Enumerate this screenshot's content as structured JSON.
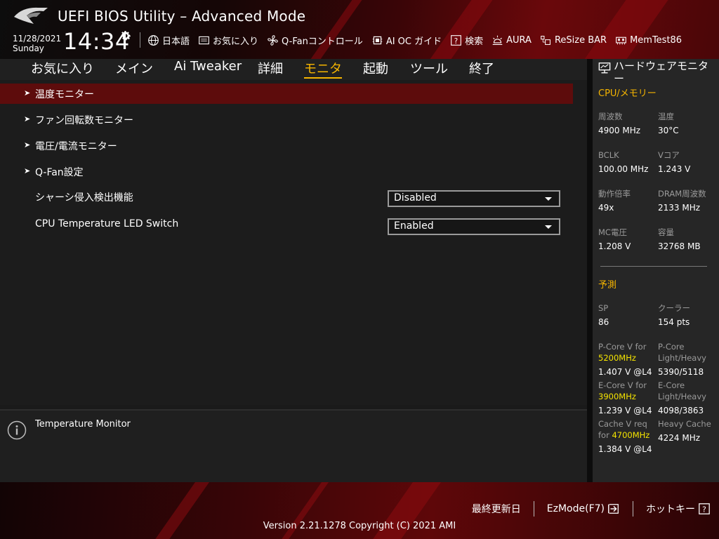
{
  "header": {
    "title": "UEFI BIOS Utility – Advanced Mode",
    "date": "11/28/2021",
    "weekday": "Sunday",
    "time": "14:34",
    "toolbar": [
      {
        "label": "日本語",
        "icon": "globe-icon"
      },
      {
        "label": "お気に入り",
        "icon": "favorites-icon"
      },
      {
        "label": "Q-Fanコントロール",
        "icon": "fan-icon"
      },
      {
        "label": "AI OC ガイド",
        "icon": "ai-oc-icon"
      },
      {
        "label": "検索",
        "icon": "search-help-icon"
      },
      {
        "label": "AURA",
        "icon": "aura-icon"
      },
      {
        "label": "ReSize BAR",
        "icon": "resize-bar-icon"
      },
      {
        "label": "MemTest86",
        "icon": "memtest-icon"
      }
    ]
  },
  "tabs": [
    {
      "label": "お気に入り",
      "active": false
    },
    {
      "label": "メイン",
      "active": false
    },
    {
      "label": "Ai Tweaker",
      "active": false
    },
    {
      "label": "詳細",
      "active": false
    },
    {
      "label": "モニタ",
      "active": true
    },
    {
      "label": "起動",
      "active": false
    },
    {
      "label": "ツール",
      "active": false
    },
    {
      "label": "終了",
      "active": false
    }
  ],
  "menu": [
    {
      "label": "温度モニター",
      "selected": true
    },
    {
      "label": "ファン回転数モニター",
      "selected": false
    },
    {
      "label": "電圧/電流モニター",
      "selected": false
    },
    {
      "label": "Q-Fan設定",
      "selected": false
    }
  ],
  "settings": [
    {
      "label": "シャーシ侵入検出機能",
      "value": "Disabled"
    },
    {
      "label": "CPU Temperature LED Switch",
      "value": "Enabled"
    }
  ],
  "help": {
    "text": "Temperature Monitor"
  },
  "hardware_monitor": {
    "title": "ハードウェアモニター",
    "cpu_section": "CPU/メモリー",
    "cpu_items": [
      {
        "label": "周波数",
        "value": "4900 MHz"
      },
      {
        "label": "温度",
        "value": "30°C"
      },
      {
        "label": "BCLK",
        "value": "100.00 MHz"
      },
      {
        "label": "Vコア",
        "value": "1.243 V"
      },
      {
        "label": "動作倍率",
        "value": "49x"
      },
      {
        "label": "DRAM周波数",
        "value": "2133 MHz"
      },
      {
        "label": "MC電圧",
        "value": "1.208 V"
      },
      {
        "label": "容量",
        "value": "32768 MB"
      }
    ],
    "predict_section": "予測",
    "sp": {
      "label": "SP",
      "value": "86"
    },
    "cooler": {
      "label": "クーラー",
      "value": "154 pts"
    },
    "pcore_v": {
      "label": "P-Core V for",
      "freq": "5200MHz",
      "value": "1.407 V @L4"
    },
    "pcore_lh": {
      "label1": "P-Core",
      "label2": "Light/Heavy",
      "value": "5390/5118"
    },
    "ecore_v": {
      "label": "E-Core V for",
      "freq": "3900MHz",
      "value": "1.239 V @L4"
    },
    "ecore_lh": {
      "label1": "E-Core",
      "label2": "Light/Heavy",
      "value": "4098/3863"
    },
    "cache_v": {
      "label1": "Cache V req",
      "label2": "for",
      "freq": "4700MHz",
      "value": "1.384 V @L4"
    },
    "heavy_cache": {
      "label": "Heavy Cache",
      "value": "4224 MHz"
    }
  },
  "footer": {
    "last_modified": "最終更新日",
    "ezmode": "EzMode(F7)",
    "hotkeys": "ホットキー",
    "version": "Version 2.21.1278 Copyright (C) 2021 AMI"
  },
  "colors": {
    "accent": "#f5b400",
    "highlight": "#f5e400",
    "selected_row": "#5d0c0c"
  }
}
